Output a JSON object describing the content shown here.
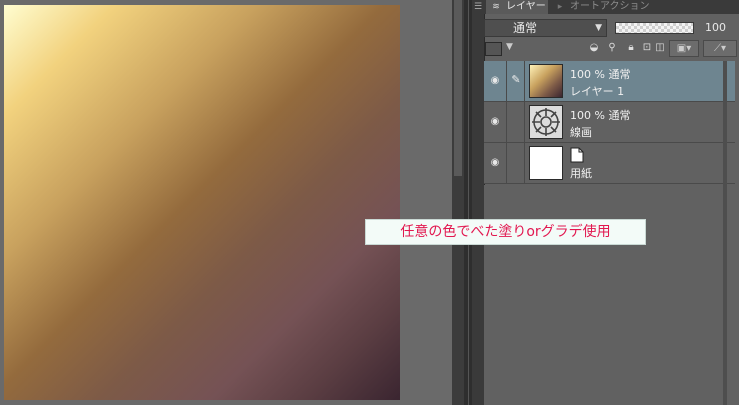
{
  "layer_panel": {
    "tabs": [
      {
        "label": "レイヤー",
        "icon": "layers-icon",
        "active": true
      },
      {
        "label": "オートアクション",
        "icon": "auto-action-icon",
        "active": false
      }
    ],
    "blend_mode": "通常",
    "opacity_value": "100",
    "layers": [
      {
        "line1": "100 % 通常",
        "line2": "レイヤー 1",
        "selected": true,
        "visible": true,
        "thumbnail": "gradient",
        "editing": true
      },
      {
        "line1": "100 % 通常",
        "line2": "線画",
        "selected": false,
        "visible": true,
        "thumbnail": "line-art",
        "editing": false
      },
      {
        "line1": "",
        "line2": "用紙",
        "selected": false,
        "visible": true,
        "thumbnail": "paper",
        "editing": false
      }
    ]
  },
  "annotation": {
    "text": "任意の色でべた塗りorグラデ使用"
  },
  "colors": {
    "panel_bg": "#616161",
    "selected_row": "#6e8590",
    "annotation_text": "#e2174f"
  }
}
